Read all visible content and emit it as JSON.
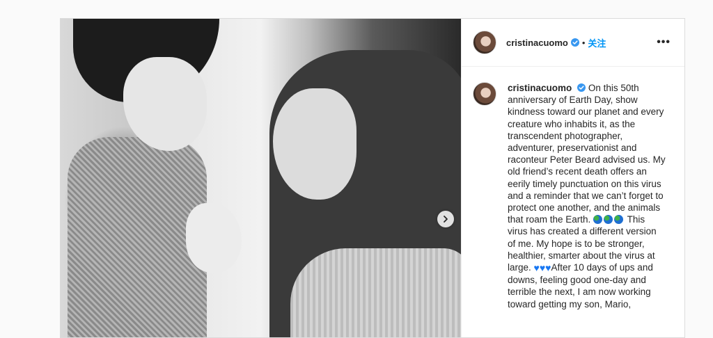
{
  "header": {
    "username": "cristinacuomo",
    "separator": "•",
    "follow_label": "关注",
    "more_label": "•••"
  },
  "caption": {
    "username": "cristinacuomo",
    "part1": "On this 50th anniversary of Earth Day, show kindness toward our planet and every creature who inhabits it, as the transcendent photographer, adventurer, preservationist and raconteur Peter Beard advised us. My old friend’s recent death offers an eerily timely punctuation on this virus and a reminder that we can’t forget to protect one another, and the animals that roam the Earth.",
    "part2": "This virus has created a different version of me. My hope is to be stronger, healthier, smarter about the virus at large.",
    "part3": "After 10 days of ups and downs, feeling good one-day and terrible the next, I am now working toward getting my son, Mario,",
    "heart_glyph": "♥"
  },
  "icons": {
    "verified": "verified-badge-icon",
    "next": "chevron-right-icon",
    "globe": "globe-emoji-icon",
    "heart": "blue-heart-emoji-icon"
  },
  "colors": {
    "link_blue": "#0095f6",
    "verified_blue": "#3897f0",
    "heart_blue": "#1877f2",
    "border": "#dbdbdb"
  }
}
